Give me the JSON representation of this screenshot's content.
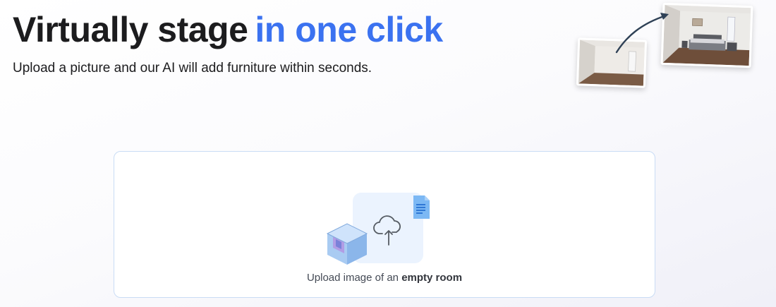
{
  "hero": {
    "title_main": "Virtually stage",
    "title_accent": "in one click",
    "subtitle": "Upload a picture and our AI will add furniture within seconds."
  },
  "illustration": {
    "before_photo": "empty-room-photo",
    "after_photo": "staged-bedroom-photo",
    "arrow": "curved-arrow-icon"
  },
  "upload": {
    "caption_prefix": "Upload image of an ",
    "caption_emphasis": "empty room",
    "icons": [
      "cube-icon",
      "cloud-upload-icon",
      "document-icon"
    ]
  },
  "colors": {
    "accent": "#3b72f0",
    "dropzone_border": "#c9dcf5",
    "text": "#1c1c1e"
  }
}
